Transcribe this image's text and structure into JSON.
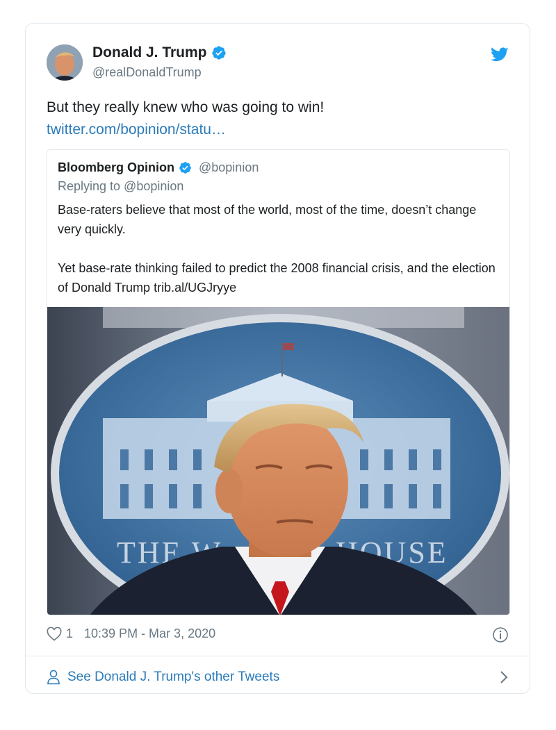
{
  "tweet": {
    "author_name": "Donald J. Trump",
    "author_handle": "@realDonaldTrump",
    "text": "But they really knew who was going to win!",
    "link_text": "twitter.com/bopinion/statu…",
    "like_count": "1",
    "timestamp": "10:39 PM - Mar 3, 2020"
  },
  "quoted_tweet": {
    "author_name": "Bloomberg Opinion",
    "author_handle": "@bopinion",
    "reply_to": "Replying to @bopinion",
    "paragraph_1": "Base-raters believe that most of the world, most of the time, doesn’t change very quickly.",
    "paragraph_2": "Yet base-rate thinking failed to predict the 2008 financial crisis, and the election of Donald Trump trib.al/UGJryye",
    "image_caption_text": "THE WHITE HOUSE"
  },
  "footer": {
    "see_more_label": "See Donald J. Trump's other Tweets"
  },
  "colors": {
    "link": "#2b7bb9",
    "verified": "#1da1f2",
    "secondary_text": "#697882",
    "border": "#e1e8ed"
  },
  "icons": {
    "twitter_logo": "twitter-bird-icon",
    "verified": "verified-badge-icon",
    "like": "heart-icon",
    "info": "info-icon",
    "person": "person-icon",
    "chevron": "chevron-right-icon"
  }
}
